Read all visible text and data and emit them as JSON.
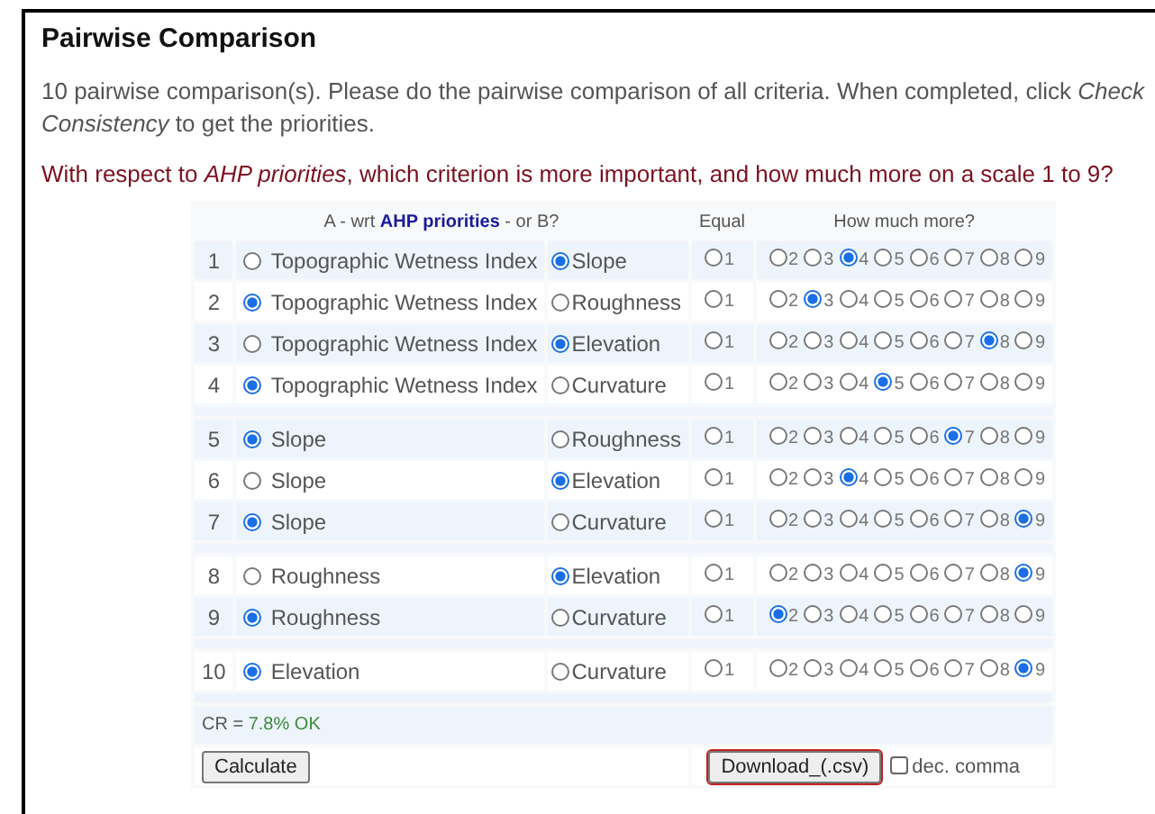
{
  "title": "Pairwise Comparison",
  "intro": "10 pairwise comparison(s). Please do the pairwise comparison of all criteria. When completed, click *Check Consistency* to get the priorities.",
  "question": "With respect to *AHP priorities*, which criterion is more important, and how much more on a scale 1 to 9?",
  "table": {
    "header_ab": "A - wrt **AHP priorities** - or B?",
    "header_equal": "Equal",
    "header_scale": "How much more?",
    "groups": [
      {
        "rows": [
          {
            "number": "1",
            "a": {
              "label": "Topographic Wetness Index",
              "selected": false
            },
            "b": {
              "label": "Slope",
              "selected": true
            },
            "equal": {
              "label": "1",
              "selected": false
            },
            "scale": [
              {
                "label": "2",
                "selected": false
              },
              {
                "label": "3",
                "selected": false
              },
              {
                "label": "4",
                "selected": true
              },
              {
                "label": "5",
                "selected": false
              },
              {
                "label": "6",
                "selected": false
              },
              {
                "label": "7",
                "selected": false
              },
              {
                "label": "8",
                "selected": false
              },
              {
                "label": "9",
                "selected": false
              }
            ]
          },
          {
            "number": "2",
            "a": {
              "label": "Topographic Wetness Index",
              "selected": true
            },
            "b": {
              "label": "Roughness",
              "selected": false
            },
            "equal": {
              "label": "1",
              "selected": false
            },
            "scale": [
              {
                "label": "2",
                "selected": false
              },
              {
                "label": "3",
                "selected": true
              },
              {
                "label": "4",
                "selected": false
              },
              {
                "label": "5",
                "selected": false
              },
              {
                "label": "6",
                "selected": false
              },
              {
                "label": "7",
                "selected": false
              },
              {
                "label": "8",
                "selected": false
              },
              {
                "label": "9",
                "selected": false
              }
            ]
          },
          {
            "number": "3",
            "a": {
              "label": "Topographic Wetness Index",
              "selected": false
            },
            "b": {
              "label": "Elevation",
              "selected": true
            },
            "equal": {
              "label": "1",
              "selected": false
            },
            "scale": [
              {
                "label": "2",
                "selected": false
              },
              {
                "label": "3",
                "selected": false
              },
              {
                "label": "4",
                "selected": false
              },
              {
                "label": "5",
                "selected": false
              },
              {
                "label": "6",
                "selected": false
              },
              {
                "label": "7",
                "selected": false
              },
              {
                "label": "8",
                "selected": true
              },
              {
                "label": "9",
                "selected": false
              }
            ]
          },
          {
            "number": "4",
            "a": {
              "label": "Topographic Wetness Index",
              "selected": true
            },
            "b": {
              "label": "Curvature",
              "selected": false
            },
            "equal": {
              "label": "1",
              "selected": false
            },
            "scale": [
              {
                "label": "2",
                "selected": false
              },
              {
                "label": "3",
                "selected": false
              },
              {
                "label": "4",
                "selected": false
              },
              {
                "label": "5",
                "selected": true
              },
              {
                "label": "6",
                "selected": false
              },
              {
                "label": "7",
                "selected": false
              },
              {
                "label": "8",
                "selected": false
              },
              {
                "label": "9",
                "selected": false
              }
            ]
          }
        ]
      },
      {
        "rows": [
          {
            "number": "5",
            "a": {
              "label": "Slope",
              "selected": true
            },
            "b": {
              "label": "Roughness",
              "selected": false
            },
            "equal": {
              "label": "1",
              "selected": false
            },
            "scale": [
              {
                "label": "2",
                "selected": false
              },
              {
                "label": "3",
                "selected": false
              },
              {
                "label": "4",
                "selected": false
              },
              {
                "label": "5",
                "selected": false
              },
              {
                "label": "6",
                "selected": false
              },
              {
                "label": "7",
                "selected": true
              },
              {
                "label": "8",
                "selected": false
              },
              {
                "label": "9",
                "selected": false
              }
            ]
          },
          {
            "number": "6",
            "a": {
              "label": "Slope",
              "selected": false
            },
            "b": {
              "label": "Elevation",
              "selected": true
            },
            "equal": {
              "label": "1",
              "selected": false
            },
            "scale": [
              {
                "label": "2",
                "selected": false
              },
              {
                "label": "3",
                "selected": false
              },
              {
                "label": "4",
                "selected": true
              },
              {
                "label": "5",
                "selected": false
              },
              {
                "label": "6",
                "selected": false
              },
              {
                "label": "7",
                "selected": false
              },
              {
                "label": "8",
                "selected": false
              },
              {
                "label": "9",
                "selected": false
              }
            ]
          },
          {
            "number": "7",
            "a": {
              "label": "Slope",
              "selected": true
            },
            "b": {
              "label": "Curvature",
              "selected": false
            },
            "equal": {
              "label": "1",
              "selected": false
            },
            "scale": [
              {
                "label": "2",
                "selected": false
              },
              {
                "label": "3",
                "selected": false
              },
              {
                "label": "4",
                "selected": false
              },
              {
                "label": "5",
                "selected": false
              },
              {
                "label": "6",
                "selected": false
              },
              {
                "label": "7",
                "selected": false
              },
              {
                "label": "8",
                "selected": false
              },
              {
                "label": "9",
                "selected": true
              }
            ]
          }
        ]
      },
      {
        "rows": [
          {
            "number": "8",
            "a": {
              "label": "Roughness",
              "selected": false
            },
            "b": {
              "label": "Elevation",
              "selected": true
            },
            "equal": {
              "label": "1",
              "selected": false
            },
            "scale": [
              {
                "label": "2",
                "selected": false
              },
              {
                "label": "3",
                "selected": false
              },
              {
                "label": "4",
                "selected": false
              },
              {
                "label": "5",
                "selected": false
              },
              {
                "label": "6",
                "selected": false
              },
              {
                "label": "7",
                "selected": false
              },
              {
                "label": "8",
                "selected": false
              },
              {
                "label": "9",
                "selected": true
              }
            ]
          },
          {
            "number": "9",
            "a": {
              "label": "Roughness",
              "selected": true
            },
            "b": {
              "label": "Curvature",
              "selected": false
            },
            "equal": {
              "label": "1",
              "selected": false
            },
            "scale": [
              {
                "label": "2",
                "selected": true
              },
              {
                "label": "3",
                "selected": false
              },
              {
                "label": "4",
                "selected": false
              },
              {
                "label": "5",
                "selected": false
              },
              {
                "label": "6",
                "selected": false
              },
              {
                "label": "7",
                "selected": false
              },
              {
                "label": "8",
                "selected": false
              },
              {
                "label": "9",
                "selected": false
              }
            ]
          }
        ]
      },
      {
        "rows": [
          {
            "number": "10",
            "a": {
              "label": "Elevation",
              "selected": true
            },
            "b": {
              "label": "Curvature",
              "selected": false
            },
            "equal": {
              "label": "1",
              "selected": false
            },
            "scale": [
              {
                "label": "2",
                "selected": false
              },
              {
                "label": "3",
                "selected": false
              },
              {
                "label": "4",
                "selected": false
              },
              {
                "label": "5",
                "selected": false
              },
              {
                "label": "6",
                "selected": false
              },
              {
                "label": "7",
                "selected": false
              },
              {
                "label": "8",
                "selected": false
              },
              {
                "label": "9",
                "selected": true
              }
            ]
          }
        ]
      }
    ],
    "cr_label": "CR = ",
    "cr_value": "7.8% OK"
  },
  "buttons": {
    "calculate": "Calculate",
    "download": "Download_(.csv)",
    "dec_comma": {
      "label": "dec. comma",
      "checked": false
    }
  }
}
